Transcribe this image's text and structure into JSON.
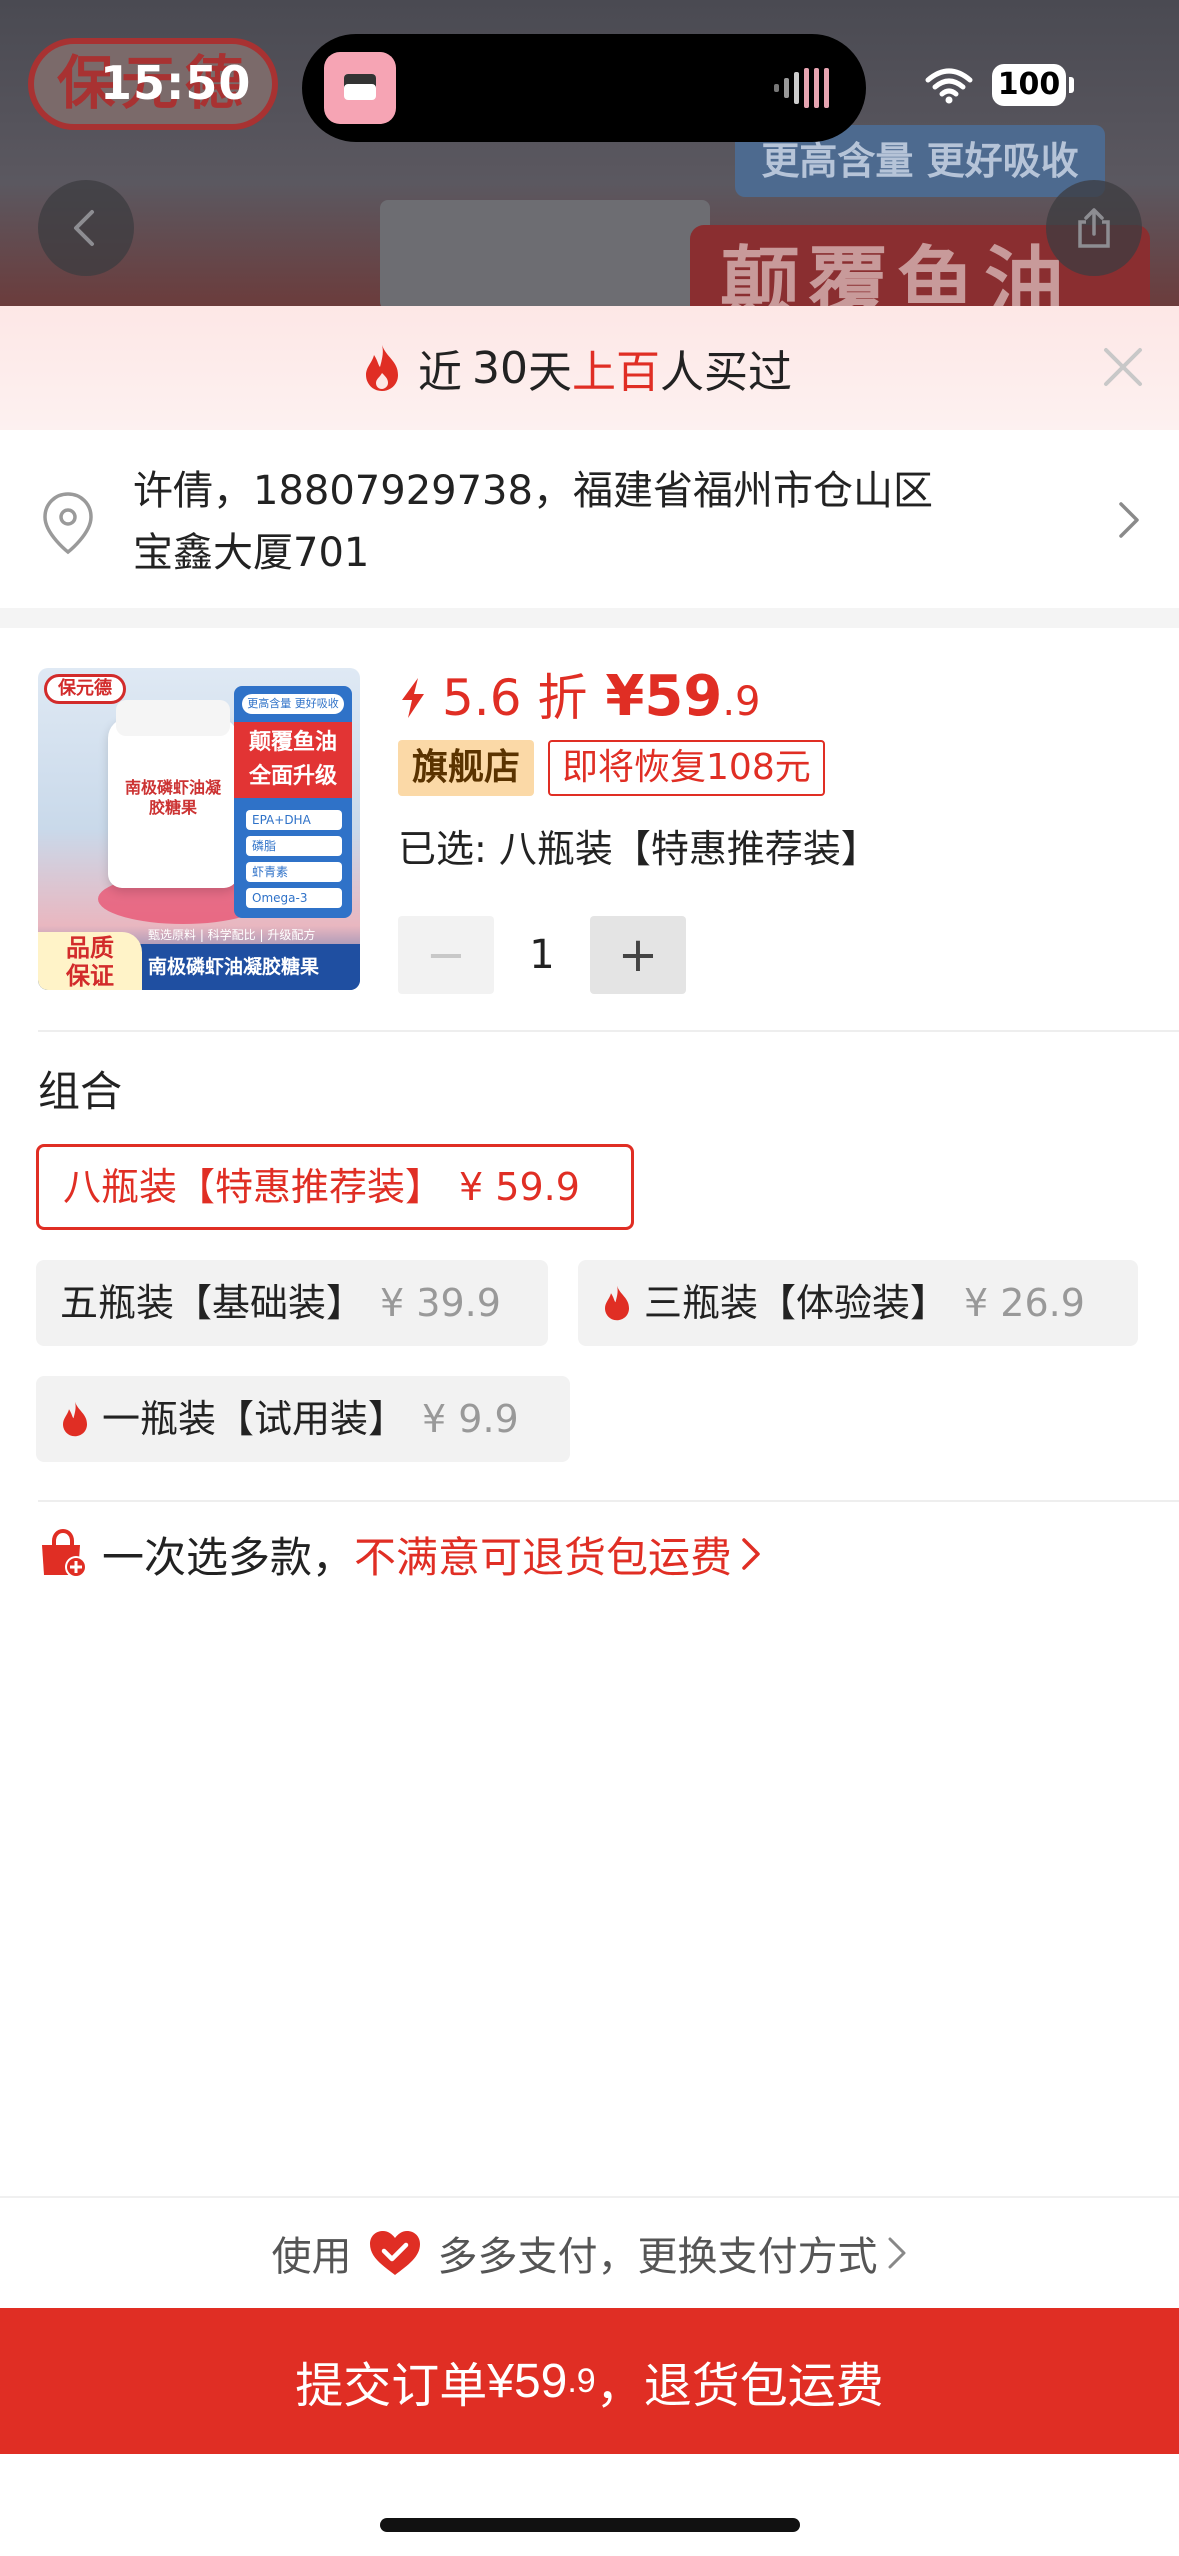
{
  "status_bar": {
    "time": "15:50",
    "battery": "100"
  },
  "background": {
    "logo": "保元德",
    "banner": "更高含量 更好吸收",
    "headline": "颠覆鱼油"
  },
  "notice": {
    "prefix": "近",
    "days": "30",
    "mid": "天",
    "hot": "上百",
    "suffix": "人买过"
  },
  "address": {
    "line1": "许倩，18807929738，福建省福州市仓山区",
    "line2": "宝鑫大厦701"
  },
  "product": {
    "image": {
      "logo": "保元德",
      "bottle_label": "南极磷虾油凝胶糖果",
      "panel_top": "更高含量 更好吸收",
      "panel_headline_1": "颠覆鱼油",
      "panel_headline_2": "全面升级",
      "panel_items": [
        "EPA+DHA",
        "磷脂",
        "虾青素",
        "Omega-3"
      ],
      "tagline": "甄选原料 | 科学配比 | 升级配方",
      "bottom_title": "南极磷虾油凝胶糖果",
      "badge_1": "品质",
      "badge_2": "保证"
    },
    "discount": "5.6 折",
    "price_int": "¥59",
    "price_dec": ".9",
    "tag_flagship": "旗舰店",
    "tag_recover": "即将恢复108元",
    "selected_label": "已选: 八瓶装【特惠推荐装】",
    "quantity": "1",
    "minus": "−",
    "plus": "+"
  },
  "combo": {
    "title": "组合",
    "options": [
      {
        "label": "八瓶装【特惠推荐装】",
        "price": "¥ 59.9",
        "active": true,
        "hot": false
      },
      {
        "label": "五瓶装【基础装】",
        "price": "¥ 39.9",
        "active": false,
        "hot": false
      },
      {
        "label": "三瓶装【体验装】",
        "price": "¥ 26.9",
        "active": false,
        "hot": true
      },
      {
        "label": "一瓶装【试用装】",
        "price": "¥ 9.9",
        "active": false,
        "hot": true
      }
    ]
  },
  "guarantee": {
    "text": "一次选多款，",
    "highlight": "不满意可退货包运费"
  },
  "payment": {
    "prefix": "使用",
    "method": "多多支付，更换支付方式"
  },
  "submit": {
    "label": "提交订单 ",
    "price_int": "¥59",
    "price_dec": ".9",
    "suffix": "，退货包运费"
  },
  "colors": {
    "accent": "#e02e24",
    "flagship_bg": "#fbd9a7",
    "notice_bg": "#fde7e6"
  },
  "icons": [
    "back-arrow-icon",
    "share-icon",
    "flame-icon",
    "close-icon",
    "location-pin-icon",
    "chevron-right-icon",
    "lightning-icon",
    "shopping-bag-icon",
    "heart-shield-icon",
    "wifi-icon",
    "signal-bars-icon"
  ]
}
